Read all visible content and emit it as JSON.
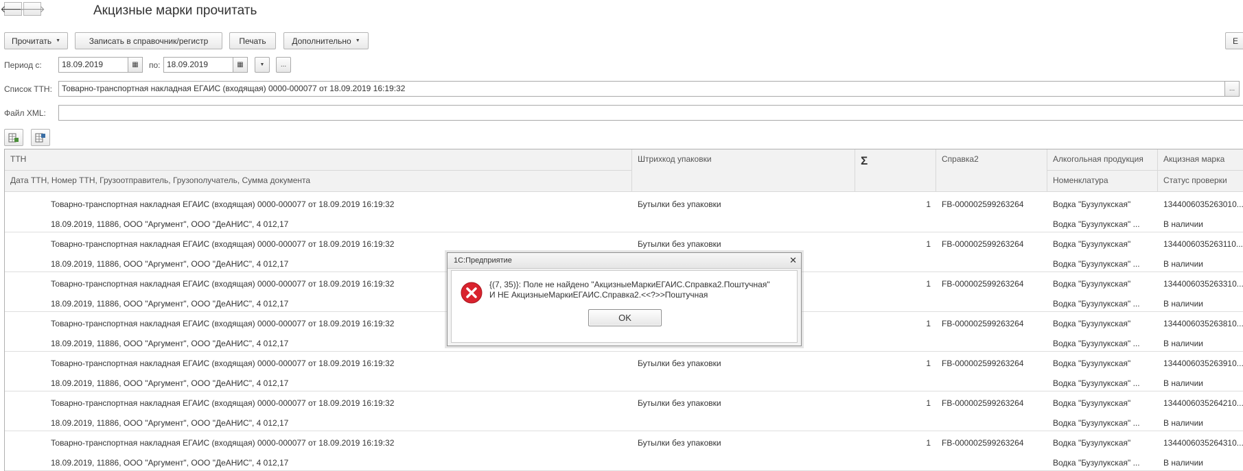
{
  "nav": {
    "back_icon": "arrow-left-icon",
    "forward_icon": "arrow-right-icon"
  },
  "title": "Акцизные марки прочитать",
  "toolbar": {
    "read_label": "Прочитать",
    "write_label": "Записать в справочник/регистр",
    "print_label": "Печать",
    "more_label": "Дополнительно",
    "right_label": "Е"
  },
  "filters": {
    "period_label": "Период с:",
    "date_from": "18.09.2019",
    "to_label": "по:",
    "date_to": "18.09.2019",
    "ellipsis": "...",
    "ttn_list_label": "Список ТТН:",
    "ttn_list_value": "Товарно-транспортная накладная ЕГАИС (входящая) 0000-000077 от 18.09.2019 16:19:32",
    "xml_label": "Файл XML:",
    "xml_value": ""
  },
  "table": {
    "headers": {
      "ttn": "ТТН",
      "ttn_sub": "Дата ТТН, Номер ТТН, Грузоотправитель, Грузополучатель, Сумма документа",
      "barcode": "Штрихкод упаковки",
      "sum_icon": "Σ",
      "spravka": "Справка2",
      "alco": "Алкогольная продукция",
      "alco_sub": "Номенклатура",
      "mark": "Акцизная марка",
      "mark_sub": "Статус проверки"
    },
    "rows": [
      {
        "ttn": "Товарно-транспортная накладная ЕГАИС (входящая) 0000-000077 от 18.09.2019 16:19:32",
        "ttn_sub": "18.09.2019, 11886, ООО \"Аргумент\", ООО \"ДеАНИС\", 4 012,17",
        "barcode": "Бутылки без упаковки",
        "qty": "1",
        "spravka": "FB-000002599263264",
        "alco": "Водка \"Бузулукская\"",
        "alco_sub": "Водка \"Бузулукская\" ...",
        "mark": "1344006035263010...",
        "status": "В наличии"
      },
      {
        "ttn": "Товарно-транспортная накладная ЕГАИС (входящая) 0000-000077 от 18.09.2019 16:19:32",
        "ttn_sub": "18.09.2019, 11886, ООО \"Аргумент\", ООО \"ДеАНИС\", 4 012,17",
        "barcode": "Бутылки без упаковки",
        "qty": "1",
        "spravka": "FB-000002599263264",
        "alco": "Водка \"Бузулукская\"",
        "alco_sub": "Водка \"Бузулукская\" ...",
        "mark": "1344006035263110...",
        "status": "В наличии"
      },
      {
        "ttn": "Товарно-транспортная накладная ЕГАИС (входящая) 0000-000077 от 18.09.2019 16:19:32",
        "ttn_sub": "18.09.2019, 11886, ООО \"Аргумент\", ООО \"ДеАНИС\", 4 012,17",
        "barcode": "",
        "qty": "1",
        "spravka": "FB-000002599263264",
        "alco": "Водка \"Бузулукская\"",
        "alco_sub": "Водка \"Бузулукская\" ...",
        "mark": "1344006035263310...",
        "status": "В наличии"
      },
      {
        "ttn": "Товарно-транспортная накладная ЕГАИС (входящая) 0000-000077 от 18.09.2019 16:19:32",
        "ttn_sub": "18.09.2019, 11886, ООО \"Аргумент\", ООО \"ДеАНИС\", 4 012,17",
        "barcode": "",
        "qty": "1",
        "spravka": "FB-000002599263264",
        "alco": "Водка \"Бузулукская\"",
        "alco_sub": "Водка \"Бузулукская\" ...",
        "mark": "1344006035263810...",
        "status": "В наличии"
      },
      {
        "ttn": "Товарно-транспортная накладная ЕГАИС (входящая) 0000-000077 от 18.09.2019 16:19:32",
        "ttn_sub": "18.09.2019, 11886, ООО \"Аргумент\", ООО \"ДеАНИС\", 4 012,17",
        "barcode": "Бутылки без упаковки",
        "qty": "1",
        "spravka": "FB-000002599263264",
        "alco": "Водка \"Бузулукская\"",
        "alco_sub": "Водка \"Бузулукская\" ...",
        "mark": "1344006035263910...",
        "status": "В наличии"
      },
      {
        "ttn": "Товарно-транспортная накладная ЕГАИС (входящая) 0000-000077 от 18.09.2019 16:19:32",
        "ttn_sub": "18.09.2019, 11886, ООО \"Аргумент\", ООО \"ДеАНИС\", 4 012,17",
        "barcode": "Бутылки без упаковки",
        "qty": "1",
        "spravka": "FB-000002599263264",
        "alco": "Водка \"Бузулукская\"",
        "alco_sub": "Водка \"Бузулукская\" ...",
        "mark": "1344006035264210...",
        "status": "В наличии"
      },
      {
        "ttn": "Товарно-транспортная накладная ЕГАИС (входящая) 0000-000077 от 18.09.2019 16:19:32",
        "ttn_sub": "18.09.2019, 11886, ООО \"Аргумент\", ООО \"ДеАНИС\", 4 012,17",
        "barcode": "Бутылки без упаковки",
        "qty": "1",
        "spravka": "FB-000002599263264",
        "alco": "Водка \"Бузулукская\"",
        "alco_sub": "Водка \"Бузулукская\" ...",
        "mark": "1344006035264310...",
        "status": "В наличии"
      }
    ]
  },
  "dialog": {
    "title": "1С:Предприятие",
    "close": "✕",
    "line1": "{(7, 35)}: Поле не найдено \"АкцизныеМаркиЕГАИС.Справка2.Поштучная\"",
    "line2": "И НЕ АкцизныеМаркиЕГАИС.Справка2.<<?>>Поштучная",
    "ok_label": "OK",
    "icon": "error-icon",
    "icon_color": "#d9232e"
  }
}
